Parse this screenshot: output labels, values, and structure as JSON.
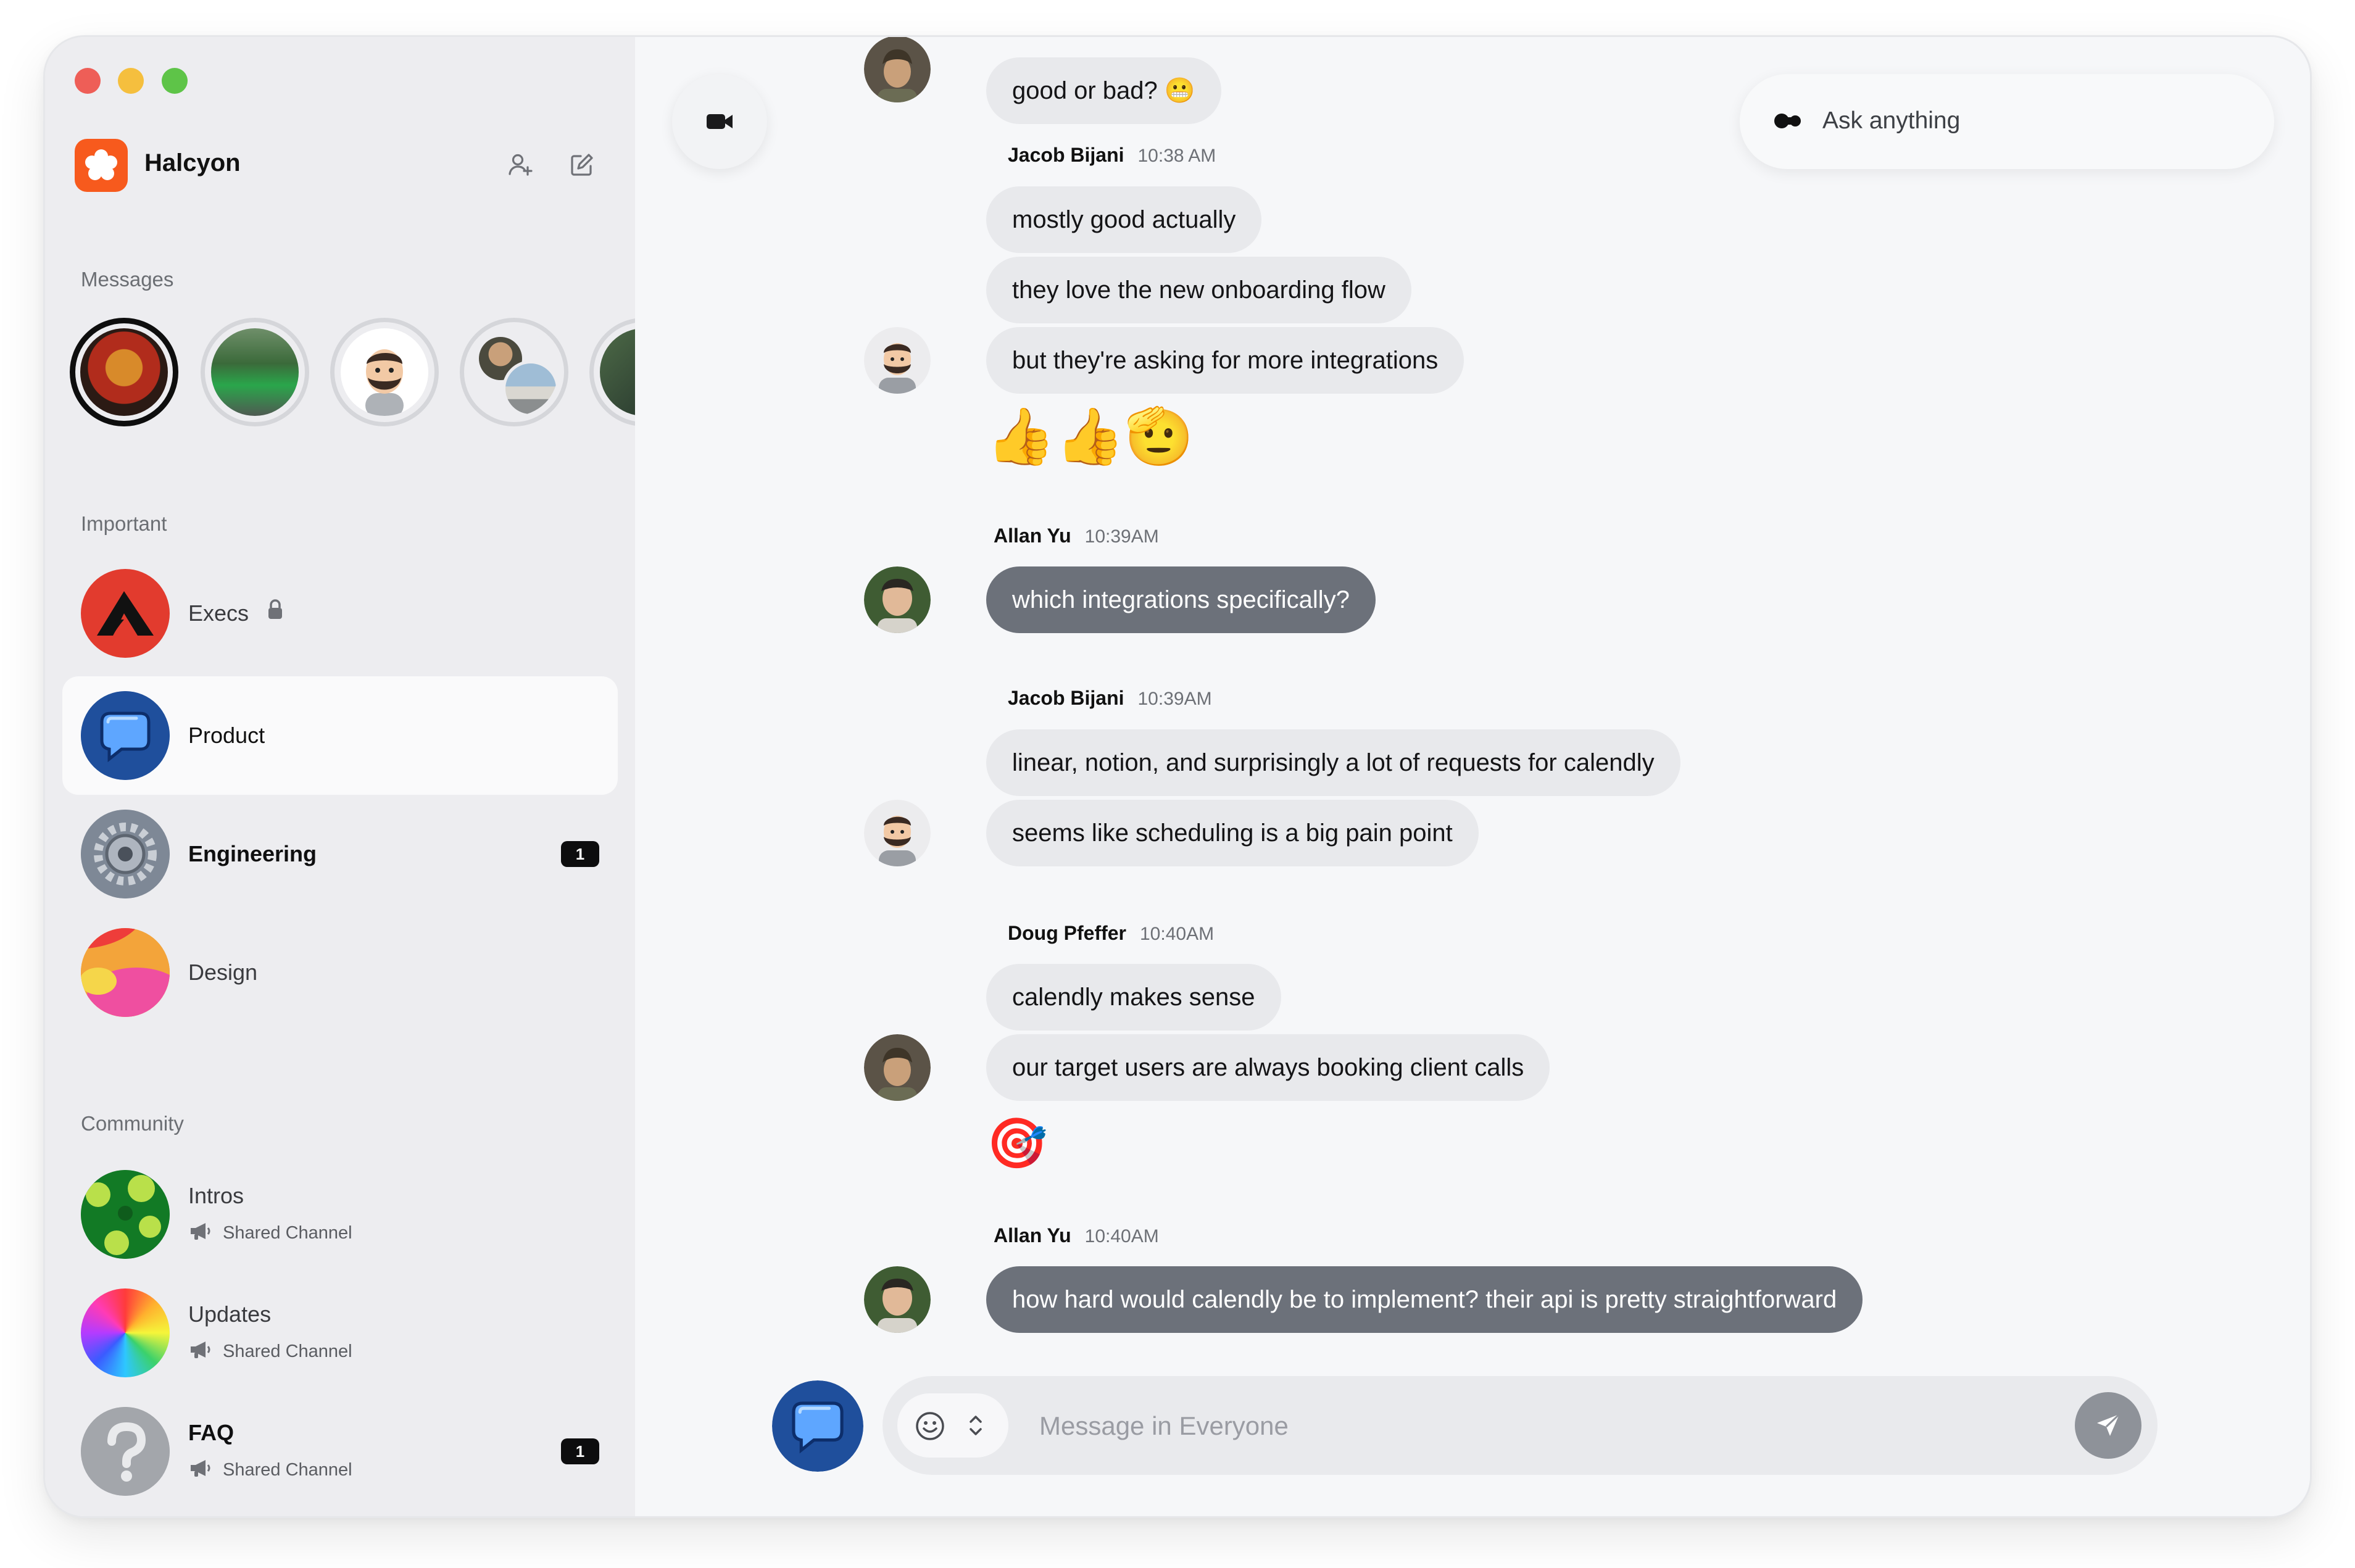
{
  "app": {
    "name": "Halcyon"
  },
  "sections": {
    "messages": "Messages",
    "important": "Important",
    "community": "Community"
  },
  "channels_important": [
    {
      "name": "Execs",
      "locked": true,
      "unread": null,
      "selected": false
    },
    {
      "name": "Product",
      "selected": true,
      "unread": null
    },
    {
      "name": "Engineering",
      "bold": true,
      "unread": "1"
    },
    {
      "name": "Design",
      "unread": null
    }
  ],
  "channels_community": [
    {
      "name": "Intros",
      "sub": "Shared Channel",
      "unread": null
    },
    {
      "name": "Updates",
      "sub": "Shared Channel",
      "unread": null
    },
    {
      "name": "FAQ",
      "sub": "Shared Channel",
      "unread": "1",
      "bold": true
    }
  ],
  "ask": {
    "label": "Ask anything"
  },
  "messages": [
    {
      "text": "good or bad? 😬"
    },
    {
      "author": "Jacob Bijani",
      "time": "10:38 AM"
    },
    {
      "text": "mostly good actually"
    },
    {
      "text": "they love the new onboarding flow"
    },
    {
      "text": "but they're asking for more integrations"
    },
    {
      "emoji": "👍👍🫡"
    },
    {
      "author": "Allan Yu",
      "time": "10:39AM"
    },
    {
      "text": "which integrations specifically?"
    },
    {
      "author": "Jacob Bijani",
      "time": "10:39AM"
    },
    {
      "text": "linear, notion, and surprisingly a lot of requests for calendly"
    },
    {
      "text": "seems like scheduling is a big pain point"
    },
    {
      "author": "Doug Pfeffer",
      "time": "10:40AM"
    },
    {
      "text": "calendly makes sense"
    },
    {
      "text": "our target users are always booking client calls"
    },
    {
      "emoji": "🎯"
    },
    {
      "author": "Allan Yu",
      "time": "10:40AM"
    },
    {
      "text": "how hard would calendly be to implement? their api is pretty straightforward"
    }
  ],
  "composer": {
    "placeholder": "Message in Everyone"
  },
  "colors": {
    "accent": "#f75a1d",
    "own_bubble": "#6c717a",
    "bubble": "#e8e9ec",
    "badge": "#0d0d0e"
  },
  "icons": [
    "add-user-icon",
    "compose-icon",
    "lock-icon",
    "megaphone-icon",
    "video-icon",
    "ai-dots-icon",
    "smile-icon",
    "chevron-updown-icon",
    "send-icon"
  ]
}
